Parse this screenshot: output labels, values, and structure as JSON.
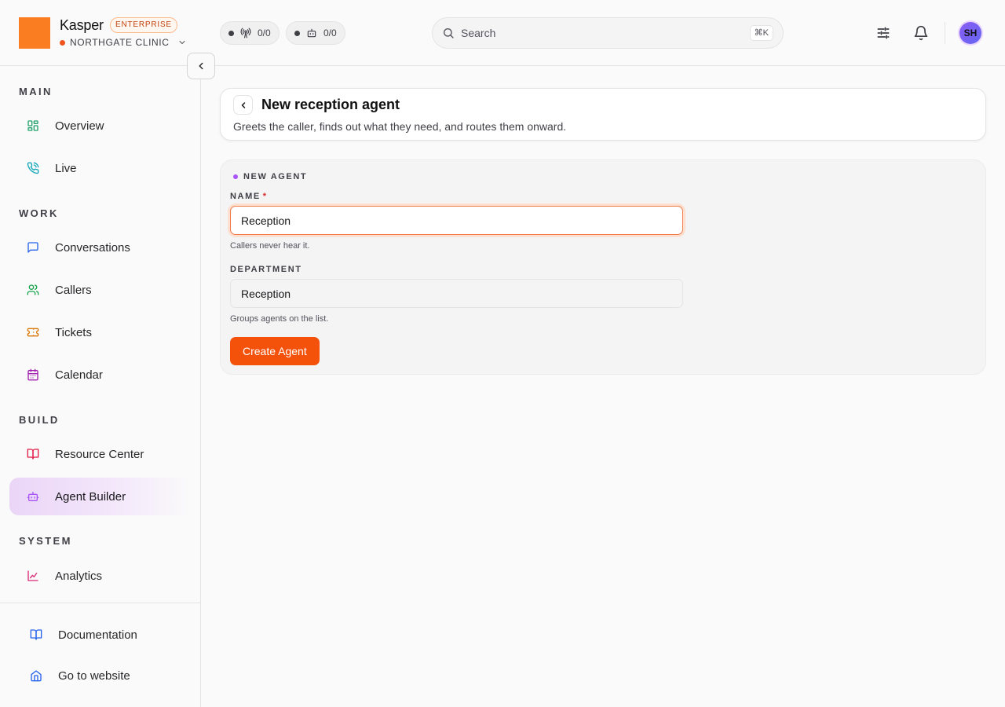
{
  "brand": {
    "name": "Kasper",
    "plan": "ENTERPRISE",
    "org": "NORTHGATE CLINIC"
  },
  "status": {
    "live": "0/0",
    "agents": "0/0"
  },
  "search": {
    "placeholder": "Search",
    "shortcut": "⌘K"
  },
  "user": {
    "initials": "SH"
  },
  "sidebar": {
    "sections": [
      "MAIN",
      "WORK",
      "BUILD",
      "SYSTEM"
    ],
    "items": [
      {
        "label": "Overview",
        "icon": "layout-grid-icon",
        "color": "#22a06b"
      },
      {
        "label": "Live",
        "icon": "phone-call-icon",
        "color": "#0ea5b7"
      },
      {
        "label": "Conversations",
        "icon": "message-square-icon",
        "color": "#2563eb"
      },
      {
        "label": "Callers",
        "icon": "users-icon",
        "color": "#16a34a"
      },
      {
        "label": "Tickets",
        "icon": "ticket-icon",
        "color": "#d97706"
      },
      {
        "label": "Calendar",
        "icon": "calendar-icon",
        "color": "#a21caf"
      },
      {
        "label": "Resource Center",
        "icon": "book-open-icon",
        "color": "#e11d48"
      },
      {
        "label": "Agent Builder",
        "icon": "bot-icon",
        "color": "#a855f7"
      },
      {
        "label": "Analytics",
        "icon": "line-chart-icon",
        "color": "#db2777"
      }
    ],
    "active": "Agent Builder",
    "footer": [
      {
        "label": "Documentation",
        "icon": "book-open-icon",
        "color": "#2563eb"
      },
      {
        "label": "Go to website",
        "icon": "home-icon",
        "color": "#2563eb"
      }
    ]
  },
  "page": {
    "title": "New reception agent",
    "subtitle": "Greets the caller, finds out what they need, and routes them onward."
  },
  "form": {
    "eyebrow": "NEW AGENT",
    "name_label": "NAME",
    "required_mark": "*",
    "name_value": "Reception",
    "name_hint": "Callers never hear it.",
    "department_label": "DEPARTMENT",
    "department_value": "Reception",
    "department_hint": "Groups agents on the list.",
    "submit_label": "Create Agent"
  },
  "colors": {
    "accent": "#f4510b",
    "brand_square": "#fb7d22",
    "active_nav": "#ead5f7"
  }
}
